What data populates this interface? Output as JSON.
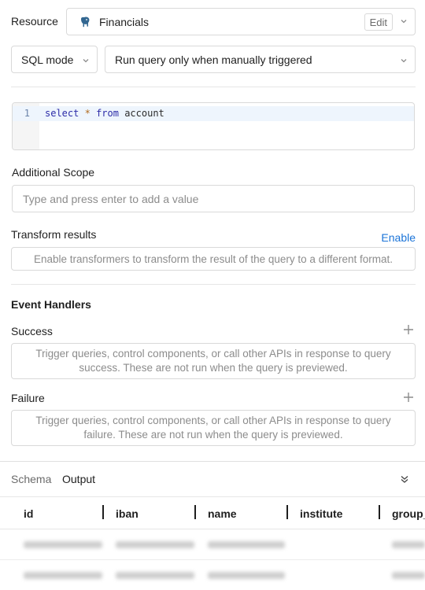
{
  "resource": {
    "label": "Resource",
    "selected": "Financials",
    "edit_label": "Edit",
    "icon": "postgres-elephant-icon"
  },
  "mode": {
    "selected": "SQL mode"
  },
  "trigger": {
    "selected": "Run query only when manually triggered"
  },
  "editor": {
    "line_number": "1",
    "code_kw1": "select",
    "code_op": "*",
    "code_kw2": "from",
    "code_table": "account"
  },
  "scope": {
    "label": "Additional Scope",
    "placeholder": "Type and press enter to add a value"
  },
  "transform": {
    "label": "Transform results",
    "enable_label": "Enable",
    "placeholder": "Enable transformers to transform the result of the query to a different format."
  },
  "event_handlers": {
    "title": "Event Handlers",
    "success_label": "Success",
    "success_text": "Trigger queries, control components, or call other APIs in response to query success. These are not run when the query is previewed.",
    "failure_label": "Failure",
    "failure_text": "Trigger queries, control components, or call other APIs in response to query failure. These are not run when the query is previewed."
  },
  "bottom": {
    "tab_schema": "Schema",
    "tab_output": "Output",
    "columns": [
      "id",
      "iban",
      "name",
      "institute",
      "group_"
    ]
  },
  "colors": {
    "accent": "#1b74d8",
    "border": "#d9d9d9",
    "placeholder": "#8c8c8c"
  }
}
